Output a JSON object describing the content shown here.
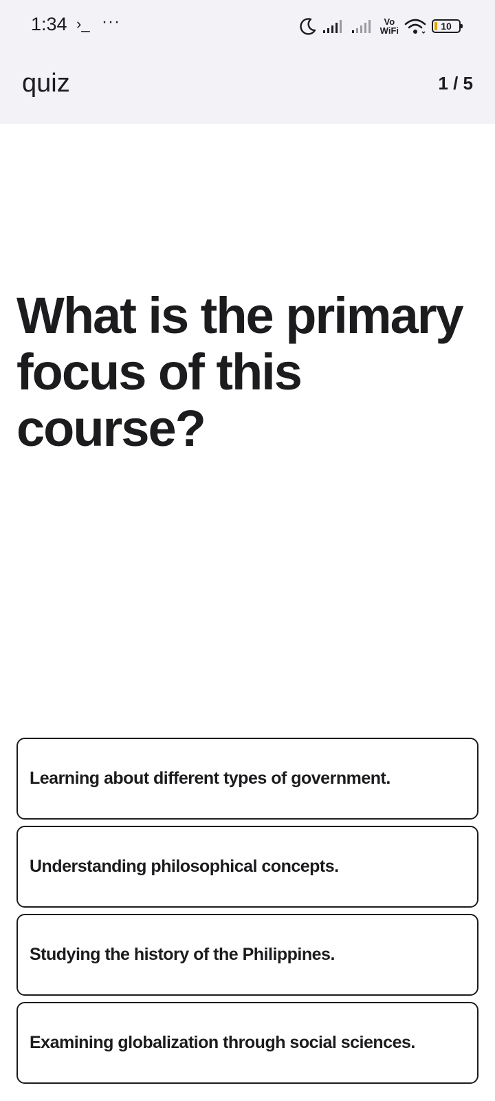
{
  "status_bar": {
    "time": "1:34",
    "prompt_icon": "terminal-prompt-icon",
    "more": "···",
    "vowifi_top": "Vo",
    "vowifi_bottom": "WiFi",
    "battery": "10",
    "icons": [
      "moon-icon",
      "signal-icon",
      "signal-icon",
      "wifi-icon",
      "battery-icon"
    ]
  },
  "header": {
    "title": "quiz",
    "progress": "1 / 5"
  },
  "question": {
    "text": "What is the primary focus of this course?"
  },
  "options": [
    {
      "label": "Learning about different types of government."
    },
    {
      "label": "Understanding philosophical concepts."
    },
    {
      "label": "Studying the history of the Philippines."
    },
    {
      "label": "Examining globalization through social sciences."
    }
  ],
  "colors": {
    "header_bg": "#f2f2f7",
    "text": "#1c1c1e",
    "border": "#1c1c1e",
    "battery_fill": "#e2a500"
  }
}
